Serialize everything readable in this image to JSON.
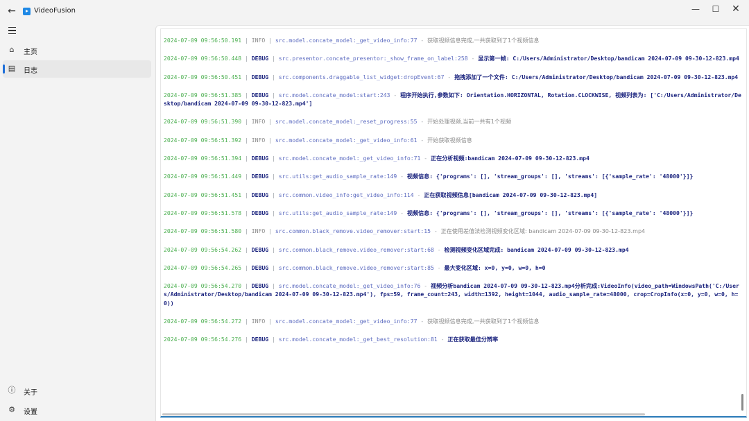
{
  "window": {
    "title": "VideoFusion",
    "back_glyph": "←",
    "min_glyph": "—",
    "max_glyph": "☐",
    "close_glyph": "✕"
  },
  "sidebar": {
    "items": [
      {
        "label": "主页",
        "icon": "home-icon",
        "glyph": "⌂"
      },
      {
        "label": "日志",
        "icon": "log-icon",
        "glyph": "▤"
      },
      {
        "label": "关于",
        "icon": "info-icon",
        "glyph": "ⓘ"
      },
      {
        "label": "设置",
        "icon": "gear-icon",
        "glyph": "⚙"
      }
    ],
    "accent": "#1e6fd9"
  },
  "colors": {
    "timestamp": "#4caf50",
    "info": "#8a8a8a",
    "debug": "#1a237e",
    "source": "#5c6bc0"
  },
  "log": {
    "entries": [
      {
        "ts": "2024-07-09 09:56:50.191",
        "level": "INFO",
        "src": "src.model.concate_model:_get_video_info:77",
        "msg": "获取视频信息完成,一共获取到了1个视频信息"
      },
      {
        "ts": "2024-07-09 09:56:50.448",
        "level": "DEBUG",
        "src": "src.presentor.concate_presentor:_show_frame_on_label:258",
        "msg": "显示第一帧: C:/Users/Administrator/Desktop/bandicam 2024-07-09 09-30-12-823.mp4"
      },
      {
        "ts": "2024-07-09 09:56:50.451",
        "level": "DEBUG",
        "src": "src.components.draggable_list_widget:dropEvent:67",
        "msg": "拖拽添加了一个文件: C:/Users/Administrator/Desktop/bandicam 2024-07-09 09-30-12-823.mp4"
      },
      {
        "ts": "2024-07-09 09:56:51.385",
        "level": "DEBUG",
        "src": "src.model.concate_model:start:243",
        "msg": "程序开始执行,参数如下: Orientation.HORIZONTAL, Rotation.CLOCKWISE, 视频列表为: ['C:/Users/Administrator/Desktop/bandicam 2024-07-09 09-30-12-823.mp4']"
      },
      {
        "ts": "2024-07-09 09:56:51.390",
        "level": "INFO",
        "src": "src.model.concate_model:_reset_progress:55",
        "msg": "开始处理视频,当前一共有1个视频"
      },
      {
        "ts": "2024-07-09 09:56:51.392",
        "level": "INFO",
        "src": "src.model.concate_model:_get_video_info:61",
        "msg": "开始获取视频信息"
      },
      {
        "ts": "2024-07-09 09:56:51.394",
        "level": "DEBUG",
        "src": "src.model.concate_model:_get_video_info:71",
        "msg": "正在分析视频:bandicam 2024-07-09 09-30-12-823.mp4"
      },
      {
        "ts": "2024-07-09 09:56:51.449",
        "level": "DEBUG",
        "src": "src.utils:get_audio_sample_rate:149",
        "msg": "视频信息: {'programs': [], 'stream_groups': [], 'streams': [{'sample_rate': '48000'}]}"
      },
      {
        "ts": "2024-07-09 09:56:51.451",
        "level": "DEBUG",
        "src": "src.common.video_info:get_video_info:114",
        "msg": "正在获取视频信息[bandicam 2024-07-09 09-30-12-823.mp4]"
      },
      {
        "ts": "2024-07-09 09:56:51.578",
        "level": "DEBUG",
        "src": "src.utils:get_audio_sample_rate:149",
        "msg": "视频信息: {'programs': [], 'stream_groups': [], 'streams': [{'sample_rate': '48000'}]}"
      },
      {
        "ts": "2024-07-09 09:56:51.580",
        "level": "INFO",
        "src": "src.common.black_remove.video_remover:start:15",
        "msg": "正在使用差值法检测视频变化区域: bandicam 2024-07-09 09-30-12-823.mp4"
      },
      {
        "ts": "2024-07-09 09:56:54.262",
        "level": "DEBUG",
        "src": "src.common.black_remove.video_remover:start:68",
        "msg": "检测视频变化区域完成: bandicam 2024-07-09 09-30-12-823.mp4"
      },
      {
        "ts": "2024-07-09 09:56:54.265",
        "level": "DEBUG",
        "src": "src.common.black_remove.video_remover:start:85",
        "msg": "最大变化区域: x=0, y=0, w=0, h=0"
      },
      {
        "ts": "2024-07-09 09:56:54.270",
        "level": "DEBUG",
        "src": "src.model.concate_model:_get_video_info:76",
        "msg": "视频分析bandicam 2024-07-09 09-30-12-823.mp4分析完成:VideoInfo(video_path=WindowsPath('C:/Users/Administrator/Desktop/bandicam 2024-07-09 09-30-12-823.mp4'), fps=59, frame_count=243, width=1392, height=1044, audio_sample_rate=48000, crop=CropInfo(x=0, y=0, w=0, h=0))"
      },
      {
        "ts": "2024-07-09 09:56:54.272",
        "level": "INFO",
        "src": "src.model.concate_model:_get_video_info:77",
        "msg": "获取视频信息完成,一共获取到了1个视频信息"
      },
      {
        "ts": "2024-07-09 09:56:54.276",
        "level": "DEBUG",
        "src": "src.model.concate_model:_get_best_resolution:81",
        "msg": "正在获取最佳分辨率"
      }
    ],
    "separator": " | ",
    "dash": " - "
  }
}
